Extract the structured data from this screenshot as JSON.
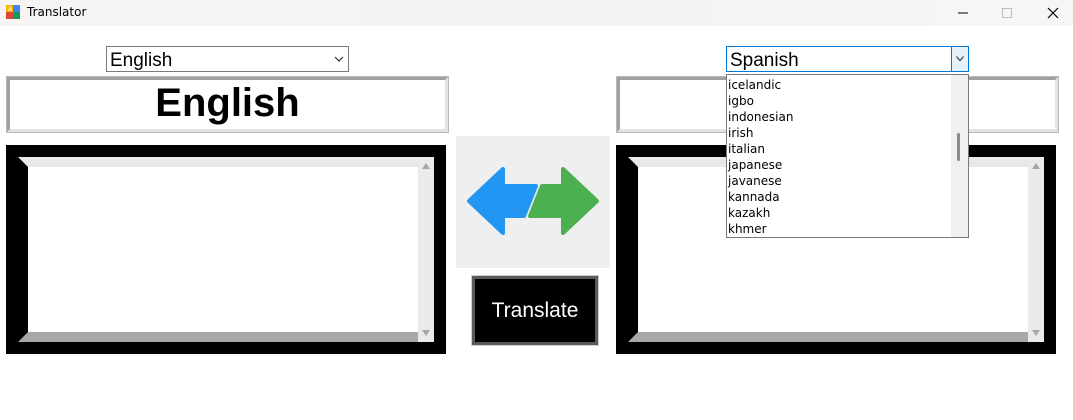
{
  "window": {
    "title": "Translator",
    "icon": "translator-app-icon",
    "controls": [
      "minimize-icon",
      "maximize-icon",
      "close-icon"
    ]
  },
  "source": {
    "selected_language": "English",
    "title": "English",
    "text": ""
  },
  "target": {
    "selected_language": "Spanish",
    "title": "",
    "text": ""
  },
  "dropdown": {
    "options": [
      "icelandic",
      "igbo",
      "indonesian",
      "irish",
      "italian",
      "japanese",
      "javanese",
      "kannada",
      "kazakh",
      "khmer"
    ]
  },
  "actions": {
    "swap_icon": "swap-arrows-icon",
    "translate_label": "Translate"
  },
  "colors": {
    "swap_left_arrow": "#2196f3",
    "swap_right_arrow": "#4caf50",
    "panel_border": "#000000",
    "translate_bg": "#000000"
  }
}
